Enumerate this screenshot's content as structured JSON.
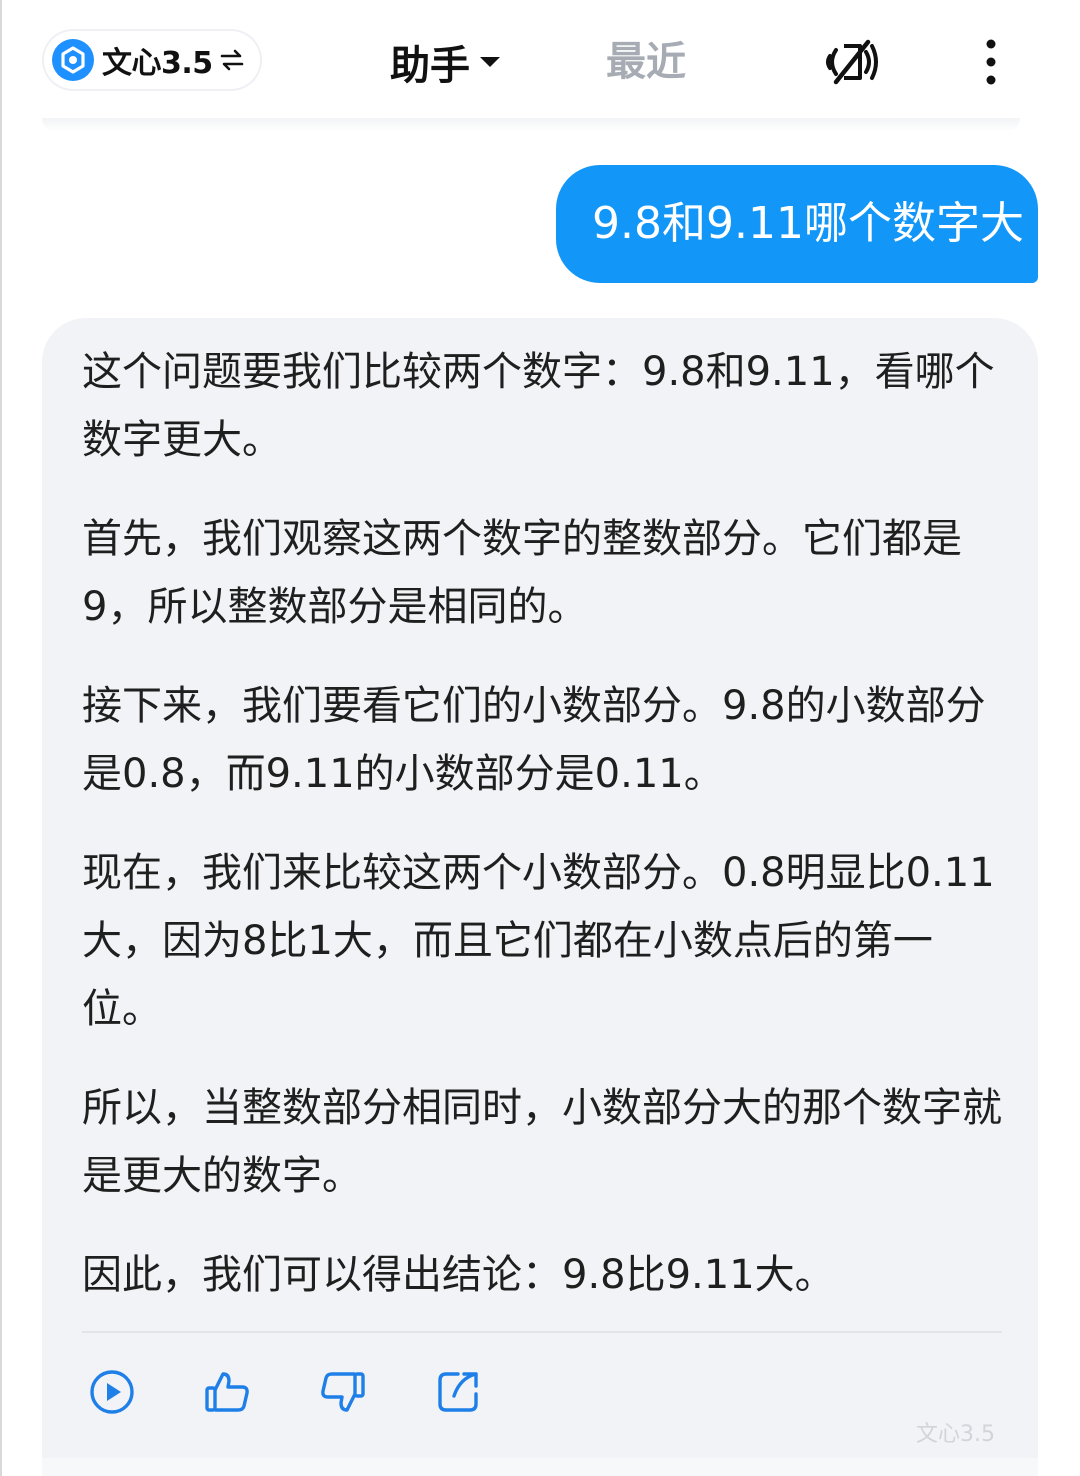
{
  "header": {
    "model_name": "文心3.5",
    "tab_assistant": "助手",
    "tab_recent": "最近",
    "icons": [
      "model-logo-icon",
      "swap-icon",
      "caret-down-icon",
      "voice-muted-icon",
      "more-vertical-icon"
    ]
  },
  "conversation": {
    "user_message": "9.8和9.11哪个数字大",
    "assistant_paragraphs": [
      "这个问题要我们比较两个数字：9.8和9.11，看哪个数字更大。",
      "首先，我们观察这两个数字的整数部分。它们都是9，所以整数部分是相同的。",
      "接下来，我们要看它们的小数部分。9.8的小数部分是0.8，而9.11的小数部分是0.11。",
      "现在，我们来比较这两个小数部分。0.8明显比0.11大，因为8比1大，而且它们都在小数点后的第一位。",
      "所以，当整数部分相同时，小数部分大的那个数字就是更大的数字。",
      "因此，我们可以得出结论：9.8比9.11大。"
    ],
    "actions": [
      "play-icon",
      "thumbs-up-icon",
      "thumbs-down-icon",
      "share-icon"
    ],
    "model_watermark": "文心3.5"
  },
  "colors": {
    "accent": "#1296f7",
    "card_bg": "#f2f3f6",
    "muted_tab": "#a7abb3"
  }
}
